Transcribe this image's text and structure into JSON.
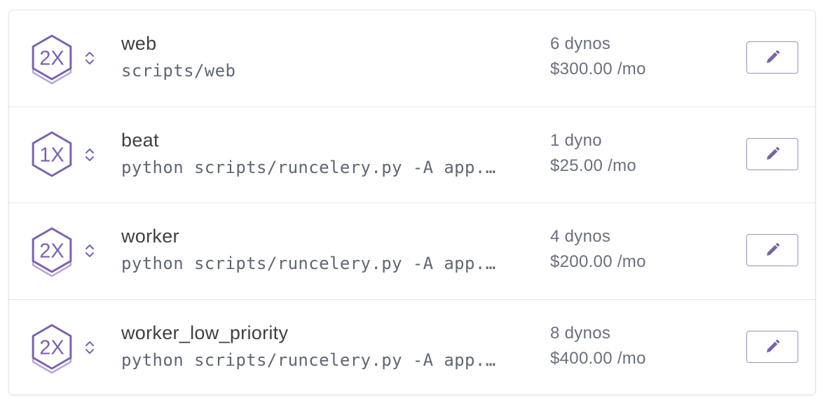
{
  "colors": {
    "accent": "#7b62b0",
    "accent_light": "#b6a8d6",
    "text_dark": "#3f3f44",
    "text_muted": "#6a7080"
  },
  "processes": [
    {
      "size": "2X",
      "name": "web",
      "command": "scripts/web",
      "dynos": "6 dynos",
      "price": "$300.00 /mo"
    },
    {
      "size": "1X",
      "name": "beat",
      "command": "python scripts/runcelery.py -A app.…",
      "dynos": "1 dyno",
      "price": "$25.00 /mo"
    },
    {
      "size": "2X",
      "name": "worker",
      "command": "python scripts/runcelery.py -A app.…",
      "dynos": "4 dynos",
      "price": "$200.00 /mo"
    },
    {
      "size": "2X",
      "name": "worker_low_priority",
      "command": "python scripts/runcelery.py -A app.…",
      "dynos": "8 dynos",
      "price": "$400.00 /mo"
    }
  ]
}
